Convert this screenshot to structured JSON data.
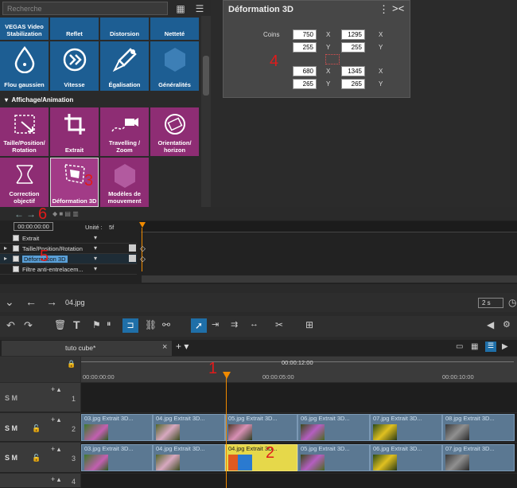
{
  "effects_panel": {
    "search_placeholder": "Recherche",
    "top_row": [
      "VEGAS Video Stabilization",
      "Reflet",
      "Distorsion",
      "Netteté"
    ],
    "row2": [
      "Flou gaussien",
      "Vitesse",
      "Égalisation",
      "Généralités"
    ],
    "section_title": "Affichage/Animation",
    "anim_row1": [
      "Taille/Position/ Rotation",
      "Extrait",
      "Travelling / Zoom",
      "Orientation/ horizon"
    ],
    "anim_row2": [
      "Correction objectif",
      "Déformation 3D",
      "Modèles de mouvement"
    ]
  },
  "dialog": {
    "title": "Déformation 3D",
    "coins_label": "Coins",
    "values": {
      "tl_x": "750",
      "tl_y": "255",
      "tr_x": "1295",
      "tr_y": "255",
      "bl_x": "680",
      "bl_y": "265",
      "br_x": "1345",
      "br_y": "265"
    },
    "x": "X",
    "y": "Y"
  },
  "keyframes": {
    "time": "00:00:00:00",
    "unit_label": "Unité :",
    "unit_value": "5f",
    "rows": [
      "Extrait",
      "Taille/Position/Rotation",
      "Déformation 3D",
      "Filtre anti-entrelacem..."
    ]
  },
  "preview_bar": {
    "file": "04.jpg",
    "duration": "2 s"
  },
  "timeline": {
    "tab": "tuto cube*",
    "ruler_top": "00:00:12:00",
    "ruler_marks": [
      "00:00:00:00",
      "00:00:05:00",
      "00:00:10:00"
    ],
    "track_numbers": [
      "1",
      "2",
      "3",
      "4"
    ],
    "track2_clips": [
      "03.jpg",
      "04.jpg",
      "05.jpg",
      "06.jpg",
      "07.jpg",
      "08.jpg"
    ],
    "track3_clips": [
      "03.jpg",
      "04.jpg",
      "04.jpg",
      "05.jpg",
      "06.jpg",
      "07.jpg"
    ],
    "clip_effect": "Extrait 3D...",
    "smp": "S M"
  },
  "annotations": [
    "1",
    "2",
    "3",
    "4",
    "5",
    "6"
  ],
  "colors": {
    "blue_tile": "#1d5e93",
    "purple_tile": "#8e2d74",
    "playhead": "#f08a00",
    "annotation": "#e01b1b"
  }
}
